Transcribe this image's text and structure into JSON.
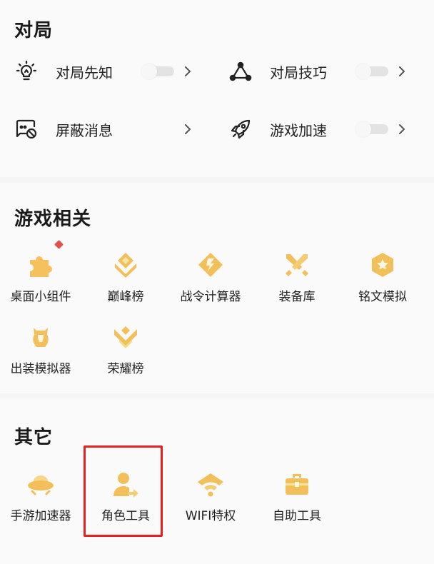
{
  "duiju": {
    "title": "对局",
    "items": [
      {
        "label": "对局先知",
        "icon": "bulb-icon",
        "toggle": true
      },
      {
        "label": "对局技巧",
        "icon": "triangle-nodes-icon",
        "toggle": true
      },
      {
        "label": "屏蔽消息",
        "icon": "block-message-icon",
        "toggle": false
      },
      {
        "label": "游戏加速",
        "icon": "rocket-icon",
        "toggle": true
      }
    ]
  },
  "game": {
    "title": "游戏相关",
    "items": [
      {
        "label": "桌面小组件",
        "icon": "puzzle-icon"
      },
      {
        "label": "巅峰榜",
        "icon": "peak-rank-icon"
      },
      {
        "label": "战令计算器",
        "icon": "battle-pass-icon"
      },
      {
        "label": "装备库",
        "icon": "crossed-swords-icon"
      },
      {
        "label": "铭文模拟",
        "icon": "inscription-icon"
      },
      {
        "label": "出装模拟器",
        "icon": "helmet-icon"
      },
      {
        "label": "荣耀榜",
        "icon": "glory-rank-icon"
      }
    ]
  },
  "other": {
    "title": "其它",
    "items": [
      {
        "label": "手游加速器",
        "icon": "ufo-icon"
      },
      {
        "label": "角色工具",
        "icon": "role-share-icon"
      },
      {
        "label": "WIFI特权",
        "icon": "wifi-icon"
      },
      {
        "label": "自助工具",
        "icon": "toolbox-icon"
      }
    ]
  },
  "colors": {
    "icon_gold": "#f2bd55",
    "icon_gold_light": "#f8d886",
    "red_dot": "#e2504a",
    "highlight": "#e8201f"
  }
}
